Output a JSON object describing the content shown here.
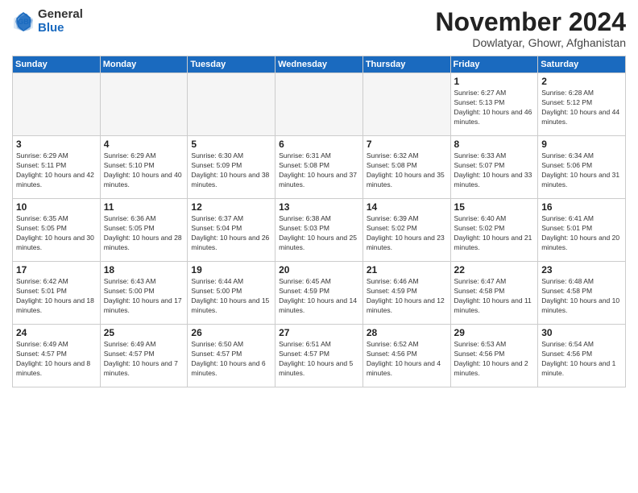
{
  "logo": {
    "general": "General",
    "blue": "Blue"
  },
  "header": {
    "month": "November 2024",
    "location": "Dowlatyar, Ghowr, Afghanistan"
  },
  "weekdays": [
    "Sunday",
    "Monday",
    "Tuesday",
    "Wednesday",
    "Thursday",
    "Friday",
    "Saturday"
  ],
  "weeks": [
    [
      {
        "day": "",
        "sunrise": "",
        "sunset": "",
        "daylight": ""
      },
      {
        "day": "",
        "sunrise": "",
        "sunset": "",
        "daylight": ""
      },
      {
        "day": "",
        "sunrise": "",
        "sunset": "",
        "daylight": ""
      },
      {
        "day": "",
        "sunrise": "",
        "sunset": "",
        "daylight": ""
      },
      {
        "day": "",
        "sunrise": "",
        "sunset": "",
        "daylight": ""
      },
      {
        "day": "1",
        "sunrise": "Sunrise: 6:27 AM",
        "sunset": "Sunset: 5:13 PM",
        "daylight": "Daylight: 10 hours and 46 minutes."
      },
      {
        "day": "2",
        "sunrise": "Sunrise: 6:28 AM",
        "sunset": "Sunset: 5:12 PM",
        "daylight": "Daylight: 10 hours and 44 minutes."
      }
    ],
    [
      {
        "day": "3",
        "sunrise": "Sunrise: 6:29 AM",
        "sunset": "Sunset: 5:11 PM",
        "daylight": "Daylight: 10 hours and 42 minutes."
      },
      {
        "day": "4",
        "sunrise": "Sunrise: 6:29 AM",
        "sunset": "Sunset: 5:10 PM",
        "daylight": "Daylight: 10 hours and 40 minutes."
      },
      {
        "day": "5",
        "sunrise": "Sunrise: 6:30 AM",
        "sunset": "Sunset: 5:09 PM",
        "daylight": "Daylight: 10 hours and 38 minutes."
      },
      {
        "day": "6",
        "sunrise": "Sunrise: 6:31 AM",
        "sunset": "Sunset: 5:08 PM",
        "daylight": "Daylight: 10 hours and 37 minutes."
      },
      {
        "day": "7",
        "sunrise": "Sunrise: 6:32 AM",
        "sunset": "Sunset: 5:08 PM",
        "daylight": "Daylight: 10 hours and 35 minutes."
      },
      {
        "day": "8",
        "sunrise": "Sunrise: 6:33 AM",
        "sunset": "Sunset: 5:07 PM",
        "daylight": "Daylight: 10 hours and 33 minutes."
      },
      {
        "day": "9",
        "sunrise": "Sunrise: 6:34 AM",
        "sunset": "Sunset: 5:06 PM",
        "daylight": "Daylight: 10 hours and 31 minutes."
      }
    ],
    [
      {
        "day": "10",
        "sunrise": "Sunrise: 6:35 AM",
        "sunset": "Sunset: 5:05 PM",
        "daylight": "Daylight: 10 hours and 30 minutes."
      },
      {
        "day": "11",
        "sunrise": "Sunrise: 6:36 AM",
        "sunset": "Sunset: 5:05 PM",
        "daylight": "Daylight: 10 hours and 28 minutes."
      },
      {
        "day": "12",
        "sunrise": "Sunrise: 6:37 AM",
        "sunset": "Sunset: 5:04 PM",
        "daylight": "Daylight: 10 hours and 26 minutes."
      },
      {
        "day": "13",
        "sunrise": "Sunrise: 6:38 AM",
        "sunset": "Sunset: 5:03 PM",
        "daylight": "Daylight: 10 hours and 25 minutes."
      },
      {
        "day": "14",
        "sunrise": "Sunrise: 6:39 AM",
        "sunset": "Sunset: 5:02 PM",
        "daylight": "Daylight: 10 hours and 23 minutes."
      },
      {
        "day": "15",
        "sunrise": "Sunrise: 6:40 AM",
        "sunset": "Sunset: 5:02 PM",
        "daylight": "Daylight: 10 hours and 21 minutes."
      },
      {
        "day": "16",
        "sunrise": "Sunrise: 6:41 AM",
        "sunset": "Sunset: 5:01 PM",
        "daylight": "Daylight: 10 hours and 20 minutes."
      }
    ],
    [
      {
        "day": "17",
        "sunrise": "Sunrise: 6:42 AM",
        "sunset": "Sunset: 5:01 PM",
        "daylight": "Daylight: 10 hours and 18 minutes."
      },
      {
        "day": "18",
        "sunrise": "Sunrise: 6:43 AM",
        "sunset": "Sunset: 5:00 PM",
        "daylight": "Daylight: 10 hours and 17 minutes."
      },
      {
        "day": "19",
        "sunrise": "Sunrise: 6:44 AM",
        "sunset": "Sunset: 5:00 PM",
        "daylight": "Daylight: 10 hours and 15 minutes."
      },
      {
        "day": "20",
        "sunrise": "Sunrise: 6:45 AM",
        "sunset": "Sunset: 4:59 PM",
        "daylight": "Daylight: 10 hours and 14 minutes."
      },
      {
        "day": "21",
        "sunrise": "Sunrise: 6:46 AM",
        "sunset": "Sunset: 4:59 PM",
        "daylight": "Daylight: 10 hours and 12 minutes."
      },
      {
        "day": "22",
        "sunrise": "Sunrise: 6:47 AM",
        "sunset": "Sunset: 4:58 PM",
        "daylight": "Daylight: 10 hours and 11 minutes."
      },
      {
        "day": "23",
        "sunrise": "Sunrise: 6:48 AM",
        "sunset": "Sunset: 4:58 PM",
        "daylight": "Daylight: 10 hours and 10 minutes."
      }
    ],
    [
      {
        "day": "24",
        "sunrise": "Sunrise: 6:49 AM",
        "sunset": "Sunset: 4:57 PM",
        "daylight": "Daylight: 10 hours and 8 minutes."
      },
      {
        "day": "25",
        "sunrise": "Sunrise: 6:49 AM",
        "sunset": "Sunset: 4:57 PM",
        "daylight": "Daylight: 10 hours and 7 minutes."
      },
      {
        "day": "26",
        "sunrise": "Sunrise: 6:50 AM",
        "sunset": "Sunset: 4:57 PM",
        "daylight": "Daylight: 10 hours and 6 minutes."
      },
      {
        "day": "27",
        "sunrise": "Sunrise: 6:51 AM",
        "sunset": "Sunset: 4:57 PM",
        "daylight": "Daylight: 10 hours and 5 minutes."
      },
      {
        "day": "28",
        "sunrise": "Sunrise: 6:52 AM",
        "sunset": "Sunset: 4:56 PM",
        "daylight": "Daylight: 10 hours and 4 minutes."
      },
      {
        "day": "29",
        "sunrise": "Sunrise: 6:53 AM",
        "sunset": "Sunset: 4:56 PM",
        "daylight": "Daylight: 10 hours and 2 minutes."
      },
      {
        "day": "30",
        "sunrise": "Sunrise: 6:54 AM",
        "sunset": "Sunset: 4:56 PM",
        "daylight": "Daylight: 10 hours and 1 minute."
      }
    ]
  ]
}
